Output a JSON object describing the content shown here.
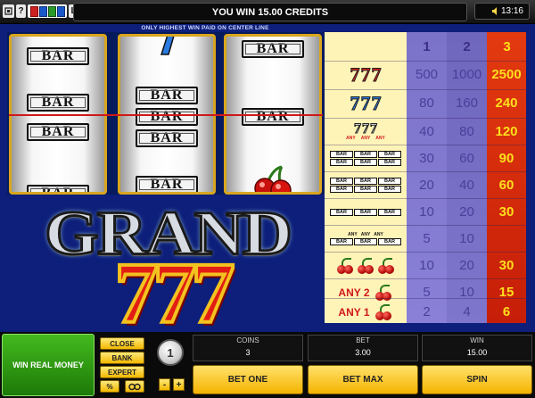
{
  "topbar": {
    "help_icon": "?",
    "cards_icon": "cards-icon",
    "menu_icon": "L",
    "message": "YOU WIN 15.00 CREDITS",
    "clock": "13:16"
  },
  "notice": "ONLY HIGHEST WIN PAID ON CENTER LINE",
  "reels": {
    "symbol_label": "BAR"
  },
  "paytable": {
    "headers": [
      "1",
      "2",
      "3"
    ],
    "rows": [
      {
        "symbol": "red-seven",
        "values": [
          "500",
          "1000",
          "2500"
        ]
      },
      {
        "symbol": "blue-seven",
        "values": [
          "80",
          "160",
          "240"
        ]
      },
      {
        "symbol": "any-seven",
        "label": "ANY",
        "values": [
          "40",
          "80",
          "120"
        ]
      },
      {
        "symbol": "triple-bar",
        "values": [
          "30",
          "60",
          "90"
        ]
      },
      {
        "symbol": "double-bar",
        "values": [
          "20",
          "40",
          "60"
        ]
      },
      {
        "symbol": "single-bar",
        "values": [
          "10",
          "20",
          "30"
        ]
      },
      {
        "symbol": "any-bar",
        "label": "ANY",
        "values": [
          "5",
          "10",
          ""
        ]
      },
      {
        "symbol": "three-cherries",
        "values": [
          "10",
          "20",
          "30"
        ]
      },
      {
        "symbol": "any-2-cherries",
        "label": "ANY 2",
        "values": [
          "5",
          "10",
          "15"
        ]
      },
      {
        "symbol": "any-1-cherry",
        "label": "ANY 1",
        "values": [
          "2",
          "4",
          "6"
        ]
      }
    ]
  },
  "logo": {
    "line1": "GRAND",
    "line2": "777"
  },
  "controls": {
    "real_money": "WIN REAL MONEY",
    "close": "CLOSE",
    "bank": "BANK",
    "expert": "EXPERT",
    "percent": "%",
    "coin_value": "1",
    "minus": "-",
    "plus": "+",
    "coins_label": "COINS",
    "coins_value": "3",
    "bet_label": "BET",
    "bet_value": "3.00",
    "win_label": "WIN",
    "win_value": "15.00",
    "bet_one": "BET ONE",
    "bet_max": "BET MAX",
    "spin": "SPIN"
  },
  "colors": {
    "background": "#0d1f7a",
    "reel_frame": "#d9a61e",
    "payline": "#d01818",
    "button_gold": "#f5b300",
    "real_money_green": "#2e9a12"
  }
}
